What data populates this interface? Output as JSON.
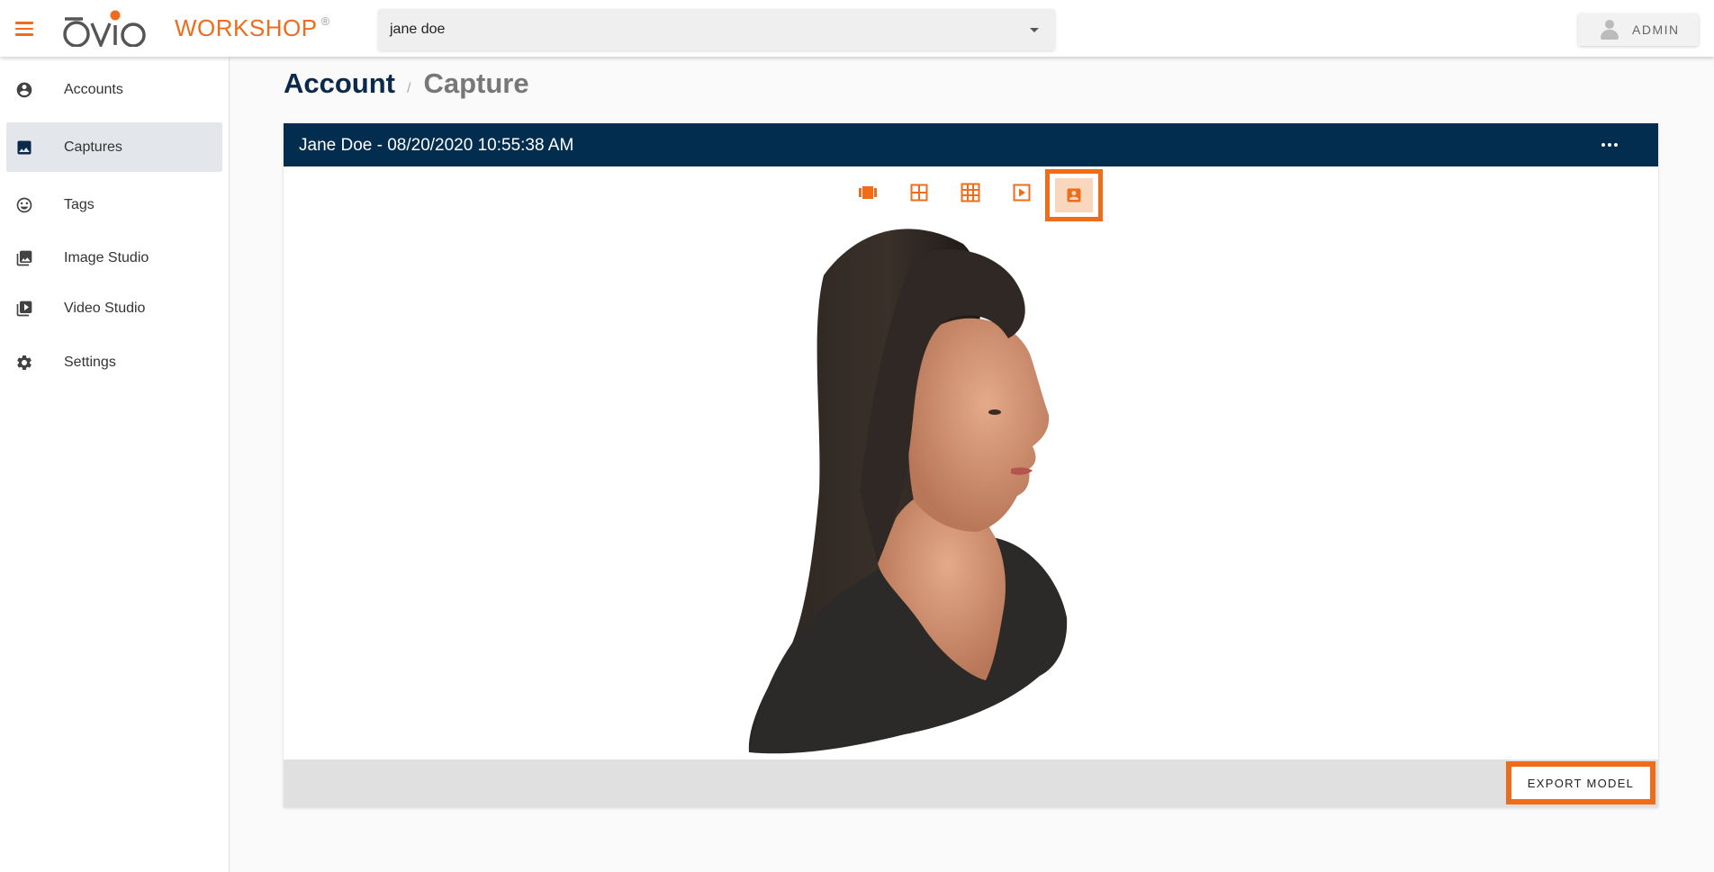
{
  "app": {
    "logo_text": "ovio",
    "logo_sub": "WORKSHOP",
    "logo_mark": "®"
  },
  "header": {
    "account_select": {
      "value": "jane doe"
    },
    "user_button": {
      "label": "ADMIN"
    }
  },
  "sidebar": {
    "items": [
      {
        "label": "Accounts",
        "icon": "account-circle-icon"
      },
      {
        "label": "Captures",
        "icon": "image-icon",
        "active": true
      },
      {
        "label": "Tags",
        "icon": "smiley-icon"
      },
      {
        "label": "Image Studio",
        "icon": "photo-library-icon"
      },
      {
        "label": "Video Studio",
        "icon": "video-studio-icon"
      },
      {
        "label": "Settings",
        "icon": "gear-icon"
      }
    ]
  },
  "breadcrumb": {
    "root": "Account",
    "separator": "/",
    "current": "Capture"
  },
  "capture": {
    "title": "Jane Doe - 08/20/2020 10:55:38 AM",
    "view_modes": [
      {
        "name": "carousel-view",
        "icon": "carousel-icon"
      },
      {
        "name": "grid-2x2-view",
        "icon": "grid-2x2-icon"
      },
      {
        "name": "grid-3x3-view",
        "icon": "grid-3x3-icon"
      },
      {
        "name": "video-view",
        "icon": "play-icon"
      },
      {
        "name": "3d-model-view",
        "icon": "portrait-icon",
        "selected": true
      }
    ],
    "export_label": "EXPORT MODEL"
  },
  "colors": {
    "accent": "#ef6c1a",
    "header_navy": "#032d4f",
    "breadcrumb_navy": "#0b2a4a",
    "active_nav_bg": "#e3e7ec"
  }
}
